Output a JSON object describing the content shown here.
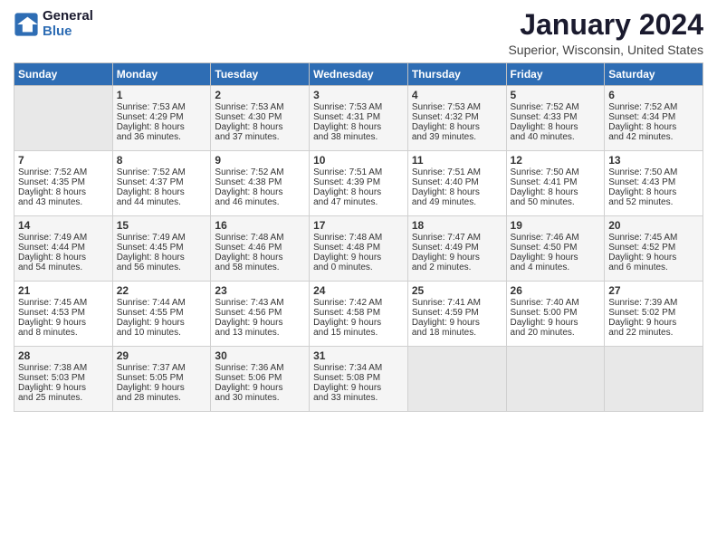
{
  "header": {
    "logo_line1": "General",
    "logo_line2": "Blue",
    "month_title": "January 2024",
    "location": "Superior, Wisconsin, United States"
  },
  "days_of_week": [
    "Sunday",
    "Monday",
    "Tuesday",
    "Wednesday",
    "Thursday",
    "Friday",
    "Saturday"
  ],
  "weeks": [
    [
      {
        "day": "",
        "sunrise": "",
        "sunset": "",
        "daylight": ""
      },
      {
        "day": "1",
        "sunrise": "Sunrise: 7:53 AM",
        "sunset": "Sunset: 4:29 PM",
        "daylight": "Daylight: 8 hours and 36 minutes."
      },
      {
        "day": "2",
        "sunrise": "Sunrise: 7:53 AM",
        "sunset": "Sunset: 4:30 PM",
        "daylight": "Daylight: 8 hours and 37 minutes."
      },
      {
        "day": "3",
        "sunrise": "Sunrise: 7:53 AM",
        "sunset": "Sunset: 4:31 PM",
        "daylight": "Daylight: 8 hours and 38 minutes."
      },
      {
        "day": "4",
        "sunrise": "Sunrise: 7:53 AM",
        "sunset": "Sunset: 4:32 PM",
        "daylight": "Daylight: 8 hours and 39 minutes."
      },
      {
        "day": "5",
        "sunrise": "Sunrise: 7:52 AM",
        "sunset": "Sunset: 4:33 PM",
        "daylight": "Daylight: 8 hours and 40 minutes."
      },
      {
        "day": "6",
        "sunrise": "Sunrise: 7:52 AM",
        "sunset": "Sunset: 4:34 PM",
        "daylight": "Daylight: 8 hours and 42 minutes."
      }
    ],
    [
      {
        "day": "7",
        "sunrise": "Sunrise: 7:52 AM",
        "sunset": "Sunset: 4:35 PM",
        "daylight": "Daylight: 8 hours and 43 minutes."
      },
      {
        "day": "8",
        "sunrise": "Sunrise: 7:52 AM",
        "sunset": "Sunset: 4:37 PM",
        "daylight": "Daylight: 8 hours and 44 minutes."
      },
      {
        "day": "9",
        "sunrise": "Sunrise: 7:52 AM",
        "sunset": "Sunset: 4:38 PM",
        "daylight": "Daylight: 8 hours and 46 minutes."
      },
      {
        "day": "10",
        "sunrise": "Sunrise: 7:51 AM",
        "sunset": "Sunset: 4:39 PM",
        "daylight": "Daylight: 8 hours and 47 minutes."
      },
      {
        "day": "11",
        "sunrise": "Sunrise: 7:51 AM",
        "sunset": "Sunset: 4:40 PM",
        "daylight": "Daylight: 8 hours and 49 minutes."
      },
      {
        "day": "12",
        "sunrise": "Sunrise: 7:50 AM",
        "sunset": "Sunset: 4:41 PM",
        "daylight": "Daylight: 8 hours and 50 minutes."
      },
      {
        "day": "13",
        "sunrise": "Sunrise: 7:50 AM",
        "sunset": "Sunset: 4:43 PM",
        "daylight": "Daylight: 8 hours and 52 minutes."
      }
    ],
    [
      {
        "day": "14",
        "sunrise": "Sunrise: 7:49 AM",
        "sunset": "Sunset: 4:44 PM",
        "daylight": "Daylight: 8 hours and 54 minutes."
      },
      {
        "day": "15",
        "sunrise": "Sunrise: 7:49 AM",
        "sunset": "Sunset: 4:45 PM",
        "daylight": "Daylight: 8 hours and 56 minutes."
      },
      {
        "day": "16",
        "sunrise": "Sunrise: 7:48 AM",
        "sunset": "Sunset: 4:46 PM",
        "daylight": "Daylight: 8 hours and 58 minutes."
      },
      {
        "day": "17",
        "sunrise": "Sunrise: 7:48 AM",
        "sunset": "Sunset: 4:48 PM",
        "daylight": "Daylight: 9 hours and 0 minutes."
      },
      {
        "day": "18",
        "sunrise": "Sunrise: 7:47 AM",
        "sunset": "Sunset: 4:49 PM",
        "daylight": "Daylight: 9 hours and 2 minutes."
      },
      {
        "day": "19",
        "sunrise": "Sunrise: 7:46 AM",
        "sunset": "Sunset: 4:50 PM",
        "daylight": "Daylight: 9 hours and 4 minutes."
      },
      {
        "day": "20",
        "sunrise": "Sunrise: 7:45 AM",
        "sunset": "Sunset: 4:52 PM",
        "daylight": "Daylight: 9 hours and 6 minutes."
      }
    ],
    [
      {
        "day": "21",
        "sunrise": "Sunrise: 7:45 AM",
        "sunset": "Sunset: 4:53 PM",
        "daylight": "Daylight: 9 hours and 8 minutes."
      },
      {
        "day": "22",
        "sunrise": "Sunrise: 7:44 AM",
        "sunset": "Sunset: 4:55 PM",
        "daylight": "Daylight: 9 hours and 10 minutes."
      },
      {
        "day": "23",
        "sunrise": "Sunrise: 7:43 AM",
        "sunset": "Sunset: 4:56 PM",
        "daylight": "Daylight: 9 hours and 13 minutes."
      },
      {
        "day": "24",
        "sunrise": "Sunrise: 7:42 AM",
        "sunset": "Sunset: 4:58 PM",
        "daylight": "Daylight: 9 hours and 15 minutes."
      },
      {
        "day": "25",
        "sunrise": "Sunrise: 7:41 AM",
        "sunset": "Sunset: 4:59 PM",
        "daylight": "Daylight: 9 hours and 18 minutes."
      },
      {
        "day": "26",
        "sunrise": "Sunrise: 7:40 AM",
        "sunset": "Sunset: 5:00 PM",
        "daylight": "Daylight: 9 hours and 20 minutes."
      },
      {
        "day": "27",
        "sunrise": "Sunrise: 7:39 AM",
        "sunset": "Sunset: 5:02 PM",
        "daylight": "Daylight: 9 hours and 22 minutes."
      }
    ],
    [
      {
        "day": "28",
        "sunrise": "Sunrise: 7:38 AM",
        "sunset": "Sunset: 5:03 PM",
        "daylight": "Daylight: 9 hours and 25 minutes."
      },
      {
        "day": "29",
        "sunrise": "Sunrise: 7:37 AM",
        "sunset": "Sunset: 5:05 PM",
        "daylight": "Daylight: 9 hours and 28 minutes."
      },
      {
        "day": "30",
        "sunrise": "Sunrise: 7:36 AM",
        "sunset": "Sunset: 5:06 PM",
        "daylight": "Daylight: 9 hours and 30 minutes."
      },
      {
        "day": "31",
        "sunrise": "Sunrise: 7:34 AM",
        "sunset": "Sunset: 5:08 PM",
        "daylight": "Daylight: 9 hours and 33 minutes."
      },
      {
        "day": "",
        "sunrise": "",
        "sunset": "",
        "daylight": ""
      },
      {
        "day": "",
        "sunrise": "",
        "sunset": "",
        "daylight": ""
      },
      {
        "day": "",
        "sunrise": "",
        "sunset": "",
        "daylight": ""
      }
    ]
  ]
}
